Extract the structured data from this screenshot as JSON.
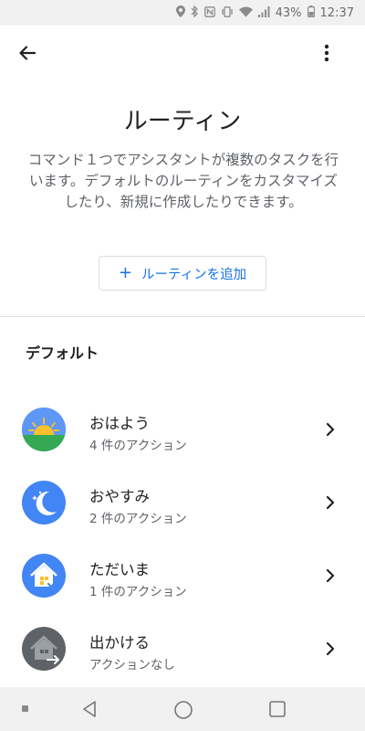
{
  "status_bar": {
    "battery": "43%",
    "time": "12:37",
    "icons": [
      "location-icon",
      "bluetooth-icon",
      "nfc-icon",
      "vibrate-icon",
      "wifi-icon",
      "signal-icon",
      "battery-icon"
    ]
  },
  "app_bar": {
    "back_icon": "arrow-back-icon",
    "overflow_icon": "more-vert-icon"
  },
  "header": {
    "title": "ルーティン",
    "description": "コマンド１つでアシスタントが複数のタスクを行います。デフォルトのルーティンをカスタマイズしたり、新規に作成したりできます。"
  },
  "add_button": {
    "icon": "+",
    "label": "ルーティンを追加",
    "color": "#1a73e8"
  },
  "section": {
    "title": "デフォルト"
  },
  "routines": [
    {
      "title": "おはよう",
      "subtitle": "4 件のアクション",
      "icon": "sunrise-icon"
    },
    {
      "title": "おやすみ",
      "subtitle": "2 件のアクション",
      "icon": "moon-icon"
    },
    {
      "title": "ただいま",
      "subtitle": "1 件のアクション",
      "icon": "home-check-icon"
    },
    {
      "title": "出かける",
      "subtitle": "アクションなし",
      "icon": "home-leave-icon"
    }
  ],
  "nav_bar": {
    "icons": [
      "nav-dot-icon",
      "nav-back-icon",
      "nav-home-icon",
      "nav-recents-icon"
    ]
  }
}
